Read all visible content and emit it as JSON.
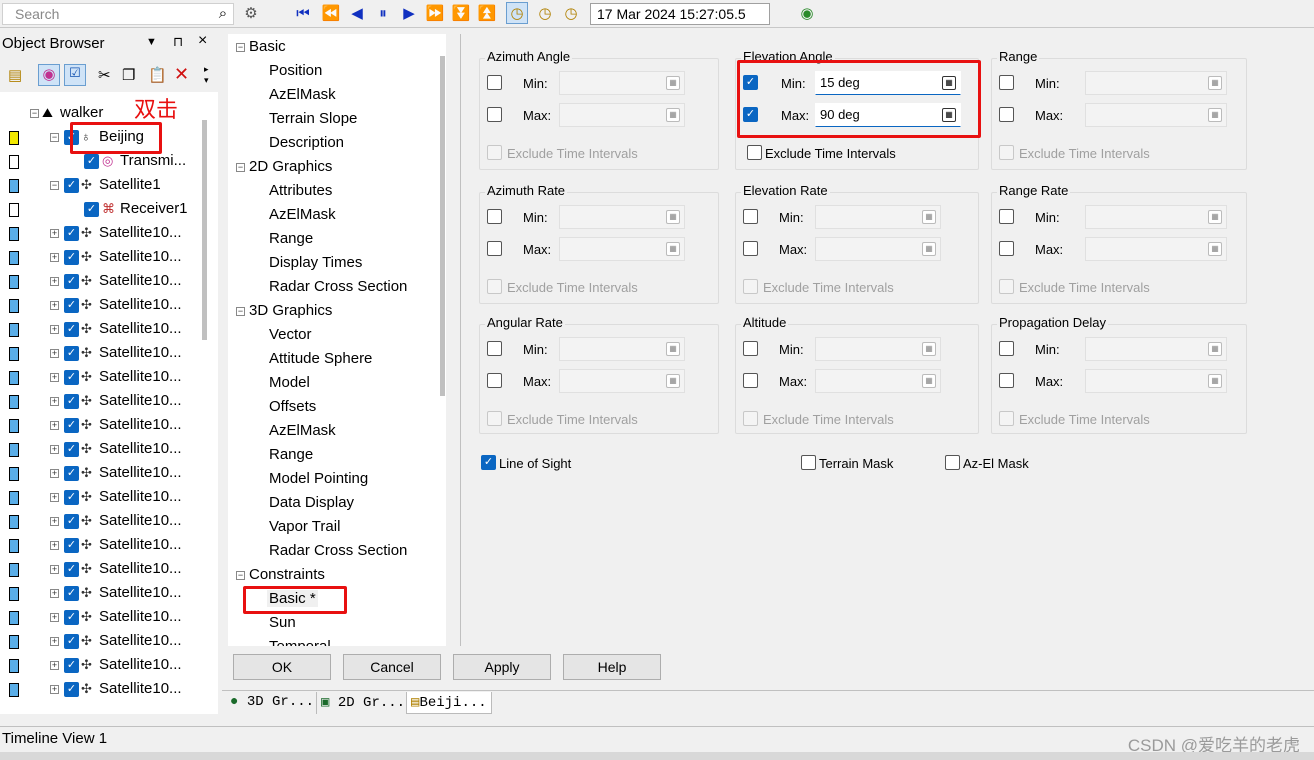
{
  "toolbar": {
    "search_placeholder": "Search",
    "time_value": "17 Mar 2024 15:27:05.5"
  },
  "object_browser": {
    "title": "Object Browser",
    "annotation": "双击",
    "root": "walker",
    "items": [
      {
        "label": "Beijing",
        "icon": "facility-icon"
      },
      {
        "label": "Transmi...",
        "icon": "transmitter-icon"
      },
      {
        "label": "Satellite1",
        "icon": "satellite-icon"
      },
      {
        "label": "Receiver1",
        "icon": "receiver-icon"
      },
      {
        "label": "Satellite10...",
        "icon": "satellite-icon"
      },
      {
        "label": "Satellite10...",
        "icon": "satellite-icon"
      },
      {
        "label": "Satellite10...",
        "icon": "satellite-icon"
      },
      {
        "label": "Satellite10...",
        "icon": "satellite-icon"
      },
      {
        "label": "Satellite10...",
        "icon": "satellite-icon"
      },
      {
        "label": "Satellite10...",
        "icon": "satellite-icon"
      },
      {
        "label": "Satellite10...",
        "icon": "satellite-icon"
      },
      {
        "label": "Satellite10...",
        "icon": "satellite-icon"
      },
      {
        "label": "Satellite10...",
        "icon": "satellite-icon"
      },
      {
        "label": "Satellite10...",
        "icon": "satellite-icon"
      },
      {
        "label": "Satellite10...",
        "icon": "satellite-icon"
      },
      {
        "label": "Satellite10...",
        "icon": "satellite-icon"
      },
      {
        "label": "Satellite10...",
        "icon": "satellite-icon"
      },
      {
        "label": "Satellite10...",
        "icon": "satellite-icon"
      },
      {
        "label": "Satellite10...",
        "icon": "satellite-icon"
      },
      {
        "label": "Satellite10...",
        "icon": "satellite-icon"
      },
      {
        "label": "Satellite10...",
        "icon": "satellite-icon"
      },
      {
        "label": "Satellite10...",
        "icon": "satellite-icon"
      },
      {
        "label": "Satellite10...",
        "icon": "satellite-icon"
      },
      {
        "label": "Satellite10...",
        "icon": "satellite-icon"
      }
    ]
  },
  "nav": {
    "sections": [
      {
        "title": "Basic",
        "items": [
          "Position",
          "AzElMask",
          "Terrain Slope",
          "Description"
        ]
      },
      {
        "title": "2D Graphics",
        "items": [
          "Attributes",
          "AzElMask",
          "Range",
          "Display Times",
          "Radar Cross Section"
        ]
      },
      {
        "title": "3D Graphics",
        "items": [
          "Vector",
          "Attitude Sphere",
          "Model",
          "Offsets",
          "AzElMask",
          "Range",
          "Model Pointing",
          "Data Display",
          "Vapor Trail",
          "Radar Cross Section"
        ]
      },
      {
        "title": "Constraints",
        "items": [
          "Basic *",
          "Sun",
          "Temporal"
        ]
      }
    ]
  },
  "constraints": {
    "min_label": "Min:",
    "max_label": "Max:",
    "exclude_label": "Exclude Time Intervals",
    "groups": [
      {
        "title": "Azimuth Angle",
        "min": "",
        "max": ""
      },
      {
        "title": "Elevation Angle",
        "min": "15 deg",
        "max": "90 deg"
      },
      {
        "title": "Range",
        "min": "",
        "max": ""
      },
      {
        "title": "Azimuth Rate",
        "min": "",
        "max": ""
      },
      {
        "title": "Elevation Rate",
        "min": "",
        "max": ""
      },
      {
        "title": "Range Rate",
        "min": "",
        "max": ""
      },
      {
        "title": "Angular Rate",
        "min": "",
        "max": ""
      },
      {
        "title": "Altitude",
        "min": "",
        "max": ""
      },
      {
        "title": "Propagation Delay",
        "min": "",
        "max": ""
      }
    ],
    "line_of_sight": "Line of Sight",
    "terrain_mask": "Terrain Mask",
    "azel_mask": "Az-El Mask"
  },
  "buttons": {
    "ok": "OK",
    "cancel": "Cancel",
    "apply": "Apply",
    "help": "Help"
  },
  "tabs": [
    "3D Gr...",
    "2D Gr...",
    "Beiji..."
  ],
  "timeline": "Timeline View 1",
  "watermark": "CSDN @爱吃羊的老虎",
  "colors": {
    "accent": "#0a66c2",
    "highlight": "#e81010"
  }
}
